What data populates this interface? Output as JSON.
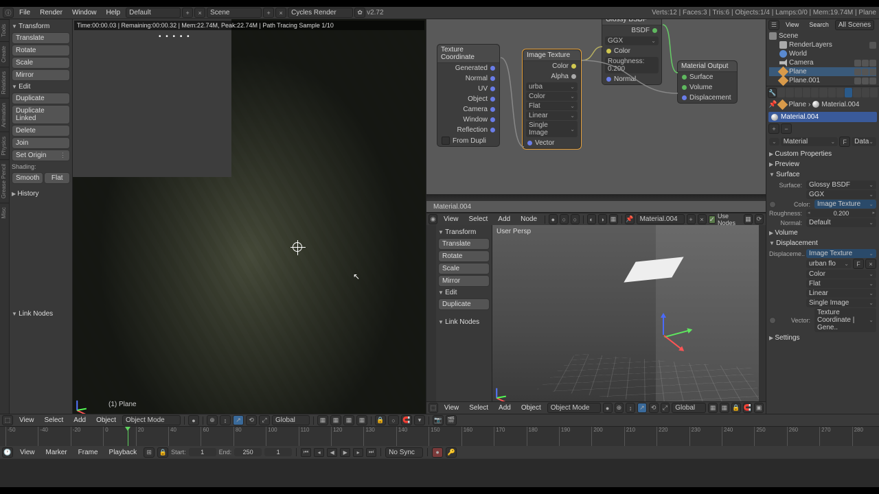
{
  "info": {
    "menus": [
      "File",
      "Render",
      "Window",
      "Help"
    ],
    "layout": "Default",
    "scene": "Scene",
    "engine": "Cycles Render",
    "version": "v2.72",
    "stats": "Verts:12  |  Faces:3  |  Tris:6  |  Objects:1/4  |  Lamps:0/0  |  Mem:19.74M  |  Plane"
  },
  "render_strip": "Time:00:00.03 | Remaining:00:00.32 | Mem:22.74M, Peak:22.74M | Path Tracing Sample 1/10",
  "viewport_label": "(1) Plane",
  "left_rail": [
    "Tools",
    "Create",
    "Relations",
    "Animation",
    "Physics",
    "Grease Pencil",
    "Misc"
  ],
  "toolshelf": {
    "transform": "Transform",
    "translate": "Translate",
    "rotate": "Rotate",
    "scale": "Scale",
    "mirror": "Mirror",
    "edit": "Edit",
    "duplicate": "Duplicate",
    "dup_linked": "Duplicate Linked",
    "delete": "Delete",
    "join": "Join",
    "set_origin": "Set Origin",
    "shading": "Shading:",
    "smooth": "Smooth",
    "flat": "Flat",
    "history": "History",
    "link_nodes": "Link Nodes"
  },
  "view_hdr": {
    "menus": [
      "View",
      "Select",
      "Add",
      "Object"
    ],
    "mode": "Object Mode",
    "orient": "Global"
  },
  "nodes": {
    "texcoord": {
      "title": "Texture Coordinate",
      "outs": [
        "Generated",
        "Normal",
        "UV",
        "Object",
        "Camera",
        "Window",
        "Reflection"
      ],
      "from_dupli": "From Dupli"
    },
    "imgtex": {
      "title": "Image Texture",
      "outs": [
        "Color",
        "Alpha"
      ],
      "img": "urba",
      "fields": [
        "Color",
        "Flat",
        "Linear",
        "Single Image"
      ],
      "vec": "Vector"
    },
    "glossy": {
      "title": "Glossy BSDF",
      "out": "BSDF",
      "dist": "GGX",
      "color": "Color",
      "rough_lbl": "Roughness:",
      "rough_val": "0.200",
      "normal": "Normal"
    },
    "output": {
      "title": "Material Output",
      "ins": [
        "Surface",
        "Volume",
        "Displacement"
      ]
    },
    "mat_name": "Material.004"
  },
  "node_hdr": {
    "menus": [
      "View",
      "Select",
      "Add",
      "Node"
    ],
    "mat": "Material.004",
    "use_nodes": "Use Nodes"
  },
  "second": {
    "persp": "User Persp",
    "shelf": {
      "transform": "Transform",
      "translate": "Translate",
      "rotate": "Rotate",
      "scale": "Scale",
      "mirror": "Mirror",
      "edit": "Edit",
      "duplicate": "Duplicate",
      "link_nodes": "Link Nodes"
    },
    "hdr": {
      "menus": [
        "View",
        "Select",
        "Add",
        "Object"
      ],
      "mode": "Object Mode",
      "orient": "Global"
    }
  },
  "outliner": {
    "filter": "All Scenes",
    "scene": "Scene",
    "rl": "RenderLayers",
    "world": "World",
    "camera": "Camera",
    "plane": "Plane",
    "plane001": "Plane.001"
  },
  "props": {
    "crumb_obj": "Plane",
    "crumb_mat": "Material.004",
    "mat_slot": "Material.004",
    "mat_field": "Material",
    "data_btn": "Data",
    "panels": {
      "custom": "Custom Properties",
      "preview": "Preview",
      "surface": "Surface",
      "volume": "Volume",
      "displacement": "Displacement",
      "settings": "Settings"
    },
    "surface_lbl": "Surface:",
    "surface_val": "Glossy BSDF",
    "dist_val": "GGX",
    "color_lbl": "Color:",
    "color_val": "Image Texture",
    "rough_lbl": "Roughness:",
    "rough_val": "0.200",
    "normal_lbl": "Normal:",
    "normal_val": "Default",
    "disp_lbl": "Displaceme..",
    "disp_val": "Image Texture",
    "img_name": "urban flo",
    "tex_fields": [
      "Color",
      "Flat",
      "Linear",
      "Single Image"
    ],
    "vector_lbl": "Vector:",
    "vector_val": "Texture Coordinate | Gene.."
  },
  "timeline": {
    "menus": [
      "View",
      "Marker",
      "Frame",
      "Playback"
    ],
    "start_lbl": "Start:",
    "start": "1",
    "end_lbl": "End:",
    "end": "250",
    "cur": "1",
    "sync": "No Sync",
    "ticks": [
      -50,
      -40,
      -20,
      0,
      20,
      40,
      60,
      80,
      100,
      120,
      140,
      160,
      180,
      200,
      220,
      240,
      260,
      280,
      300,
      320,
      350,
      380,
      400,
      450,
      500,
      550,
      600,
      650,
      700,
      800,
      900,
      1000,
      1100,
      1200,
      1280
    ],
    "tick_labels": [
      "-50",
      "-40",
      "-20",
      "0",
      "20",
      "40",
      "60",
      "80",
      "100",
      "110",
      "120",
      "130",
      "140",
      "150",
      "160",
      "170",
      "180",
      "190",
      "200",
      "210",
      "220",
      "230",
      "240",
      "250",
      "260",
      "270",
      "280"
    ]
  }
}
